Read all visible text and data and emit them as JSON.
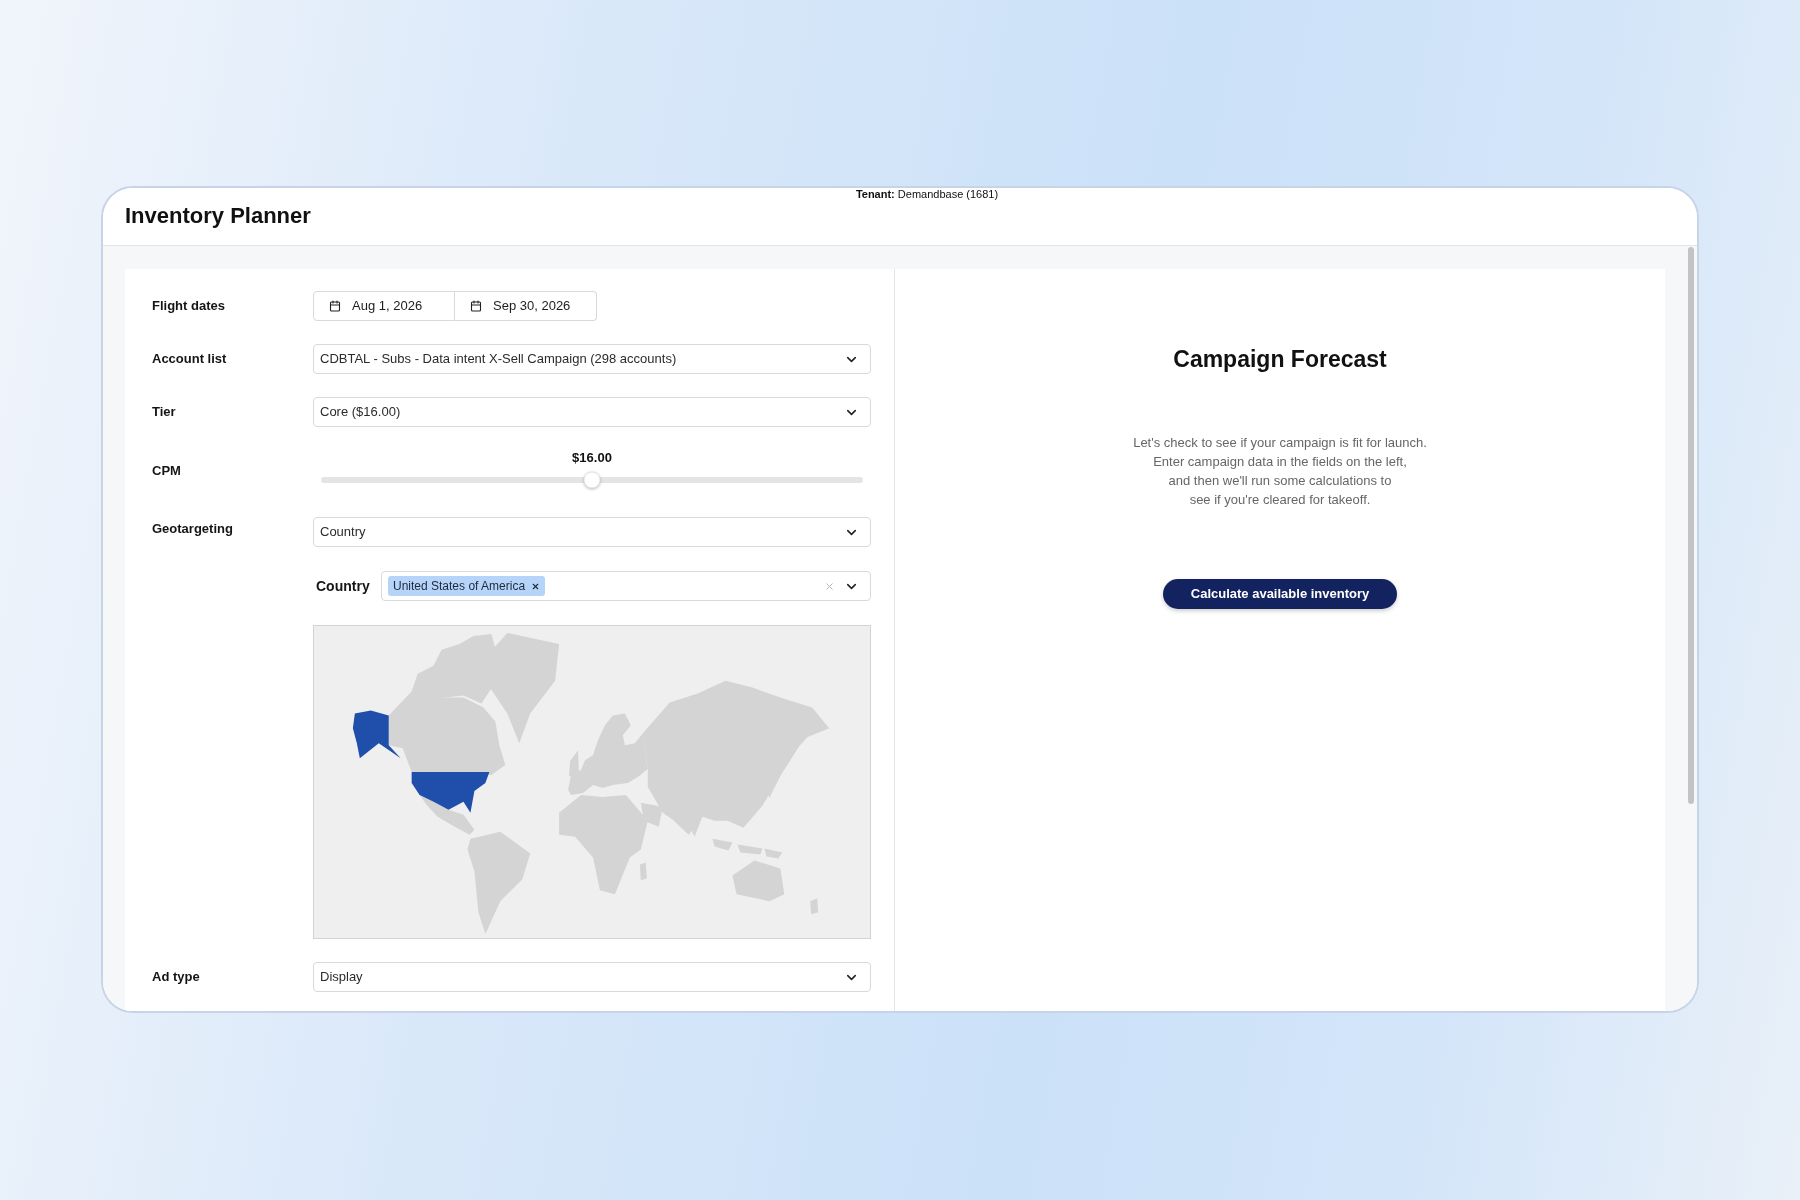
{
  "header": {
    "tenant": "**Tenant:** Demandbase (1681)",
    "title": "Inventory Planner"
  },
  "form": {
    "flight_dates": {
      "label": "Flight dates",
      "start": "Aug 1, 2026",
      "end": "Sep 30, 2026"
    },
    "account_list": {
      "label": "Account list",
      "value": "CDBTAL - Subs - Data intent X-Sell Campaign (298 accounts)"
    },
    "tier": {
      "label": "Tier",
      "value": "Core ($16.00)"
    },
    "cpm": {
      "label": "CPM",
      "reading": "$16.00",
      "level": 0.5
    },
    "geotargeting": {
      "label": "Geotargeting",
      "value": "Country",
      "country": {
        "label": "Country",
        "tags": [
          "United States of America"
        ]
      }
    },
    "ad_type": {
      "label": "Ad type",
      "value": "Display"
    }
  },
  "forecast": {
    "title": "Campaign Forecast",
    "lines": [
      "Let's check to see if your campaign is fit for launch.",
      "Enter campaign data in the fields on the left,",
      "and then we'll run some calculations to",
      "see if you're cleared for takeoff."
    ],
    "button": "Calculate available inventory"
  }
}
